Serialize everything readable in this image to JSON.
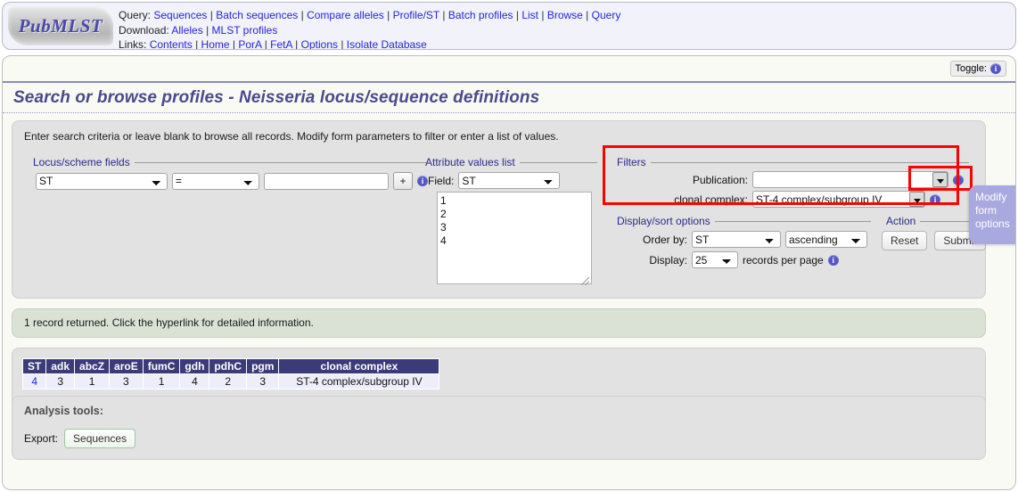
{
  "header": {
    "logo_text": "PubMLST",
    "rows": [
      {
        "label": "Query:",
        "links": [
          "Sequences",
          "Batch sequences",
          "Compare alleles",
          "Profile/ST",
          "Batch profiles",
          "List",
          "Browse",
          "Query"
        ]
      },
      {
        "label": "Download:",
        "links": [
          "Alleles",
          "MLST profiles"
        ]
      },
      {
        "label": "Links:",
        "links": [
          "Contents",
          "Home",
          "PorA",
          "FetA",
          "Options",
          "Isolate Database"
        ]
      }
    ]
  },
  "toggle": {
    "label": "Toggle:",
    "icon": "info-icon"
  },
  "page_title": "Search or browse profiles - Neisseria locus/sequence definitions",
  "search": {
    "intro": "Enter search criteria or leave blank to browse all records. Modify form parameters to filter or enter a list of values.",
    "locus_fieldset": {
      "legend": "Locus/scheme fields",
      "field_value": "ST",
      "operator_value": "=",
      "text_value": "",
      "add_button": "+",
      "info_icon": "info-icon"
    },
    "attribute_fieldset": {
      "legend": "Attribute values list",
      "field_label": "Field:",
      "field_value": "ST",
      "values_text": "1\n2\n3\n4"
    },
    "filters_fieldset": {
      "legend": "Filters",
      "publication_label": "Publication:",
      "publication_value": "",
      "clonal_complex_label": "clonal complex:",
      "clonal_complex_value": "ST-4 complex/subgroup IV",
      "info_icon": "info-icon"
    },
    "display_fieldset": {
      "legend": "Display/sort options",
      "order_by_label": "Order by:",
      "order_by_value": "ST",
      "direction_value": "ascending",
      "display_label": "Display:",
      "records_value": "25",
      "records_suffix": "records per page",
      "info_icon": "info-icon"
    },
    "action_fieldset": {
      "legend": "Action",
      "reset_label": "Reset",
      "submit_label": "Submit"
    },
    "modify_tab": "Modify form options"
  },
  "result_message": "1 record returned. Click the hyperlink for detailed information.",
  "results_table": {
    "columns": [
      "ST",
      "adk",
      "abcZ",
      "aroE",
      "fumC",
      "gdh",
      "pdhC",
      "pgm",
      "clonal complex"
    ],
    "rows": [
      [
        "4",
        "3",
        "1",
        "3",
        "1",
        "4",
        "2",
        "3",
        "ST-4 complex/subgroup IV"
      ]
    ]
  },
  "analysis": {
    "title": "Analysis tools:",
    "export_label": "Export:",
    "export_button": "Sequences"
  },
  "colors": {
    "accent_link": "#2525d8",
    "title": "#4a4a8c",
    "table_header": "#3b3b7a",
    "result_panel": "#d9e2d5",
    "highlight": "#ff0000",
    "modify_tab": "#a9a9e0"
  }
}
